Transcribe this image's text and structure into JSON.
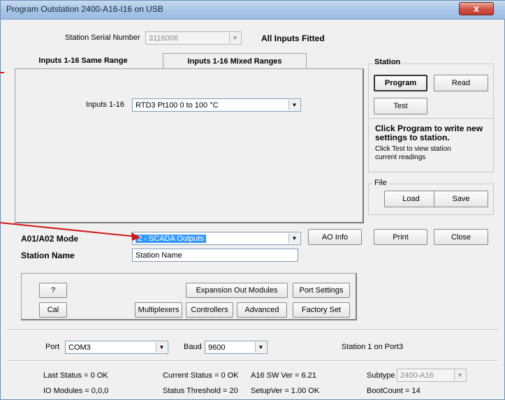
{
  "window": {
    "title": "Program Outstation 2400-A16-I16 on USB",
    "close_glyph": "x"
  },
  "station_serial": {
    "label": "Station Serial Number",
    "value": "3116006",
    "inputs_status": "All Inputs Fitted"
  },
  "tabs": [
    {
      "label": "Inputs 1-16 Same Range"
    },
    {
      "label": "Inputs 1-16 Mixed Ranges"
    }
  ],
  "inputs": {
    "label": "Inputs 1-16",
    "value": "RTD3 Pt100 0 to 100 °C"
  },
  "station_group": {
    "caption": "Station",
    "program": "Program",
    "read": "Read",
    "test": "Test",
    "info_bold": "Click Program to write new settings to station.",
    "info_normal": "Click Test to view station current readings"
  },
  "file_group": {
    "caption": "File",
    "load": "Load",
    "save": "Save"
  },
  "ao_mode": {
    "label": "A01/A02 Mode",
    "value": "2 - SCADA Outputs",
    "info_button": "AO Info"
  },
  "print_button": "Print",
  "close_button": "Close",
  "station_name": {
    "label": "Station Name",
    "value": "Station Name"
  },
  "tools": {
    "help": "?",
    "cal": "Cal",
    "multiplexers": "Multiplexers",
    "expansion": "Expansion Out Modules",
    "controllers": "Controllers",
    "advanced": "Advanced",
    "port_settings": "Port Settings",
    "factory_set": "Factory Set"
  },
  "comm": {
    "port_label": "Port",
    "port_value": "COM3",
    "baud_label": "Baud",
    "baud_value": "9600",
    "station_on_port": "Station 1 on Port3"
  },
  "status": {
    "last_status": "Last Status = 0 OK",
    "current_status": "Current Status = 0 OK",
    "sw_ver": "A16 SW Ver = 6.21",
    "subtype_label": "Subtype",
    "subtype_value": "2400-A16",
    "io_modules": "IO Modules = 0,0,0",
    "status_threshold": "Status Threshold = 20",
    "setup_ver": "SetupVer = 1.00 OK",
    "boot_count": "BootCount = 14"
  },
  "colors": {
    "selected_bg": "#3399ff",
    "annotation_arrow": "#d01818"
  },
  "icons": {
    "dropdown": "chevron-down-icon"
  }
}
